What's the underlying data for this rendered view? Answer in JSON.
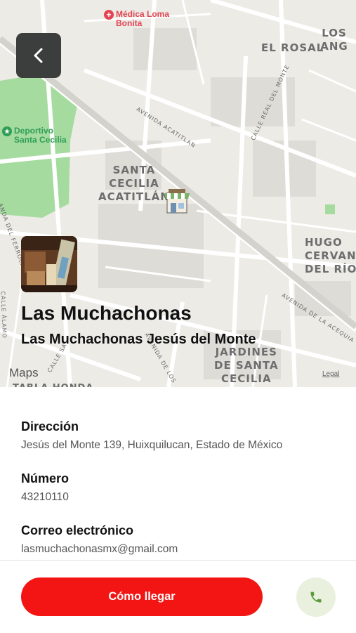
{
  "map": {
    "labels": {
      "medica": "Médica Loma Bonita",
      "los_angeles": "LOS ANG",
      "el_rosal": "EL ROSAL",
      "deportivo": "Deportivo Santa Cecilia",
      "santa_cecilia_1": "SANTA",
      "santa_cecilia_2": "CECILIA",
      "santa_cecilia_3": "ACATITLÁN",
      "hugo_1": "HUGO",
      "hugo_2": "CERVANT",
      "hugo_3": "DEL RÍO",
      "jardines_1": "JARDINES",
      "jardines_2": "DE SANTA",
      "jardines_3": "CECILIA",
      "tabla": "TABLA HONDA",
      "av_acatitlan": "AVENIDA ACATITLAN",
      "calle_real": "CALLE REAL DEL MONTE",
      "av_acequia": "AVENIDA DE LA ACEQUIA",
      "del_ferro": "ANDA DEL FERROCARRIL",
      "calle_alamo": "CALLE ÁLAMO",
      "calle_sa": "CALLE SA",
      "avenida_los": "AVENIDA DE LOS"
    },
    "attribution": "Maps",
    "legal": "Legal"
  },
  "place": {
    "title": "Las Muchachonas",
    "subtitle": "Las Muchachonas  Jesús del Monte"
  },
  "details": {
    "address_label": "Dirección",
    "address_value": "Jesús del Monte 139, Huixquilucan, Estado de México",
    "phone_label": "Número",
    "phone_value": "43210110",
    "email_label": "Correo electrónico",
    "email_value": "lasmuchachonasmx@gmail.com"
  },
  "actions": {
    "directions_label": "Cómo llegar"
  },
  "colors": {
    "primary": "#f21513",
    "call_bg": "#e9f1de",
    "call_icon": "#5a9a3a",
    "park": "#9fd89a"
  }
}
